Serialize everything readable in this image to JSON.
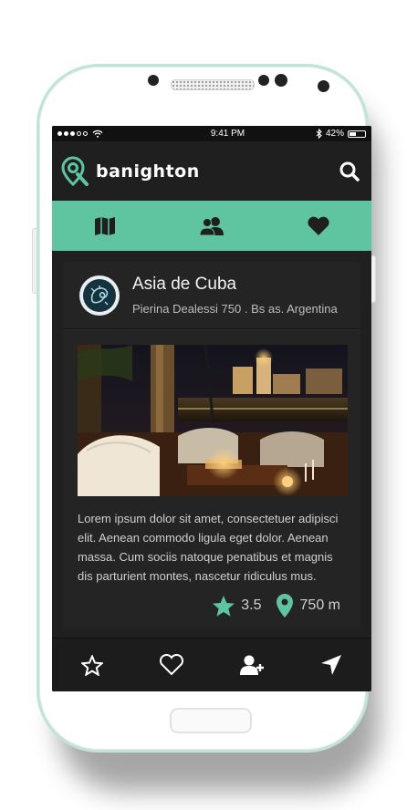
{
  "status_bar": {
    "time": "9:41 PM",
    "battery_text": "42%",
    "battery_level": 0.42
  },
  "app": {
    "brand_name": "banighton",
    "accent_color": "#5fc4a0"
  },
  "tabs": [
    {
      "icon": "map-icon"
    },
    {
      "icon": "friends-icon"
    },
    {
      "icon": "heart-icon"
    }
  ],
  "venue": {
    "name": "Asia de Cuba",
    "address": "Pierina Dealessi 750 . Bs as. Argentina",
    "description": "Lorem ipsum dolor sit amet, consectetuer adipisci elit. Aenean commodo ligula eget dolor. Aenean massa. Cum sociis natoque penatibus et magnis dis parturient montes, nascetur ridiculus mus.",
    "rating": "3.5",
    "distance": "750 m"
  },
  "bottom_actions": [
    {
      "icon": "star-outline-icon"
    },
    {
      "icon": "heart-outline-icon"
    },
    {
      "icon": "add-user-icon"
    },
    {
      "icon": "navigate-icon"
    }
  ]
}
